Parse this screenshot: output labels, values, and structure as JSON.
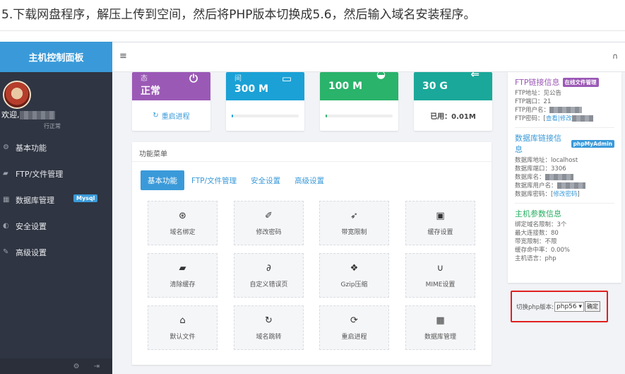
{
  "caption": "5.下载网盘程序，解压上传到空间，然后将PHP版本切换成5.6，然后输入域名安装程序。",
  "sidebar": {
    "brand": "主机控制面板",
    "welcome": "欢迎,",
    "status": "行正常",
    "items": [
      {
        "label": "基本功能",
        "icon": "gears-icon"
      },
      {
        "label": "FTP/文件管理",
        "icon": "folder-icon"
      },
      {
        "label": "数据库管理",
        "icon": "table-icon",
        "badge": "Mysql"
      },
      {
        "label": "安全设置",
        "icon": "shield-icon"
      },
      {
        "label": "高级设置",
        "icon": "edit-icon"
      }
    ]
  },
  "cards": [
    {
      "small": "态",
      "value": "正常",
      "footer": "重启进程",
      "color": "#9b59b6"
    },
    {
      "small": "间",
      "value": "300 M",
      "color": "#1ba1d6"
    },
    {
      "value": "100 M",
      "color": "#2ab36b"
    },
    {
      "value": "30 G",
      "footer": "已用：0.01M",
      "color": "#1aa89a"
    }
  ],
  "panel": {
    "title": "功能菜单",
    "tabs": [
      "基本功能",
      "FTP/文件管理",
      "安全设置",
      "高级设置"
    ],
    "tiles": [
      {
        "label": "域名绑定",
        "icon": "dribbble-icon"
      },
      {
        "label": "修改密码",
        "icon": "wrench-icon"
      },
      {
        "label": "带宽限制",
        "icon": "rocket-icon"
      },
      {
        "label": "缓存设置",
        "icon": "save-icon"
      },
      {
        "label": "清除缓存",
        "icon": "eraser-icon"
      },
      {
        "label": "自定义错误页",
        "icon": "paperclip-icon"
      },
      {
        "label": "Gzip压缩",
        "icon": "dropbox-icon"
      },
      {
        "label": "MIME设置",
        "icon": "magnet-icon"
      },
      {
        "label": "默认文件",
        "icon": "home-icon"
      },
      {
        "label": "域名跳转",
        "icon": "repeat-icon"
      },
      {
        "label": "重启进程",
        "icon": "refresh-icon"
      },
      {
        "label": "数据库管理",
        "icon": "table-icon"
      }
    ]
  },
  "ftp": {
    "title": "FTP链接信息",
    "tag": "在线文件管理",
    "lines": [
      "FTP地址：见公告",
      "FTP端口：21",
      "FTP用户名：",
      "FTP密码：["
    ],
    "link": "查看|修改"
  },
  "db": {
    "title": "数据库链接信息",
    "tag": "phpMyAdmin",
    "lines": [
      "数据库地址：localhost",
      "数据库端口：3306",
      "数据库名：",
      "数据库用户名：",
      "数据库密码：["
    ],
    "link": "修改密码"
  },
  "host": {
    "title": "主机参数信息",
    "lines": [
      "绑定域名限制：3个",
      "最大连接数：80",
      "带宽限制：不限",
      "缓存命中率：0.00%",
      "主机语言：php"
    ]
  },
  "php_switch": {
    "label": "切换php版本:",
    "selected": "php56",
    "button": "确定"
  }
}
